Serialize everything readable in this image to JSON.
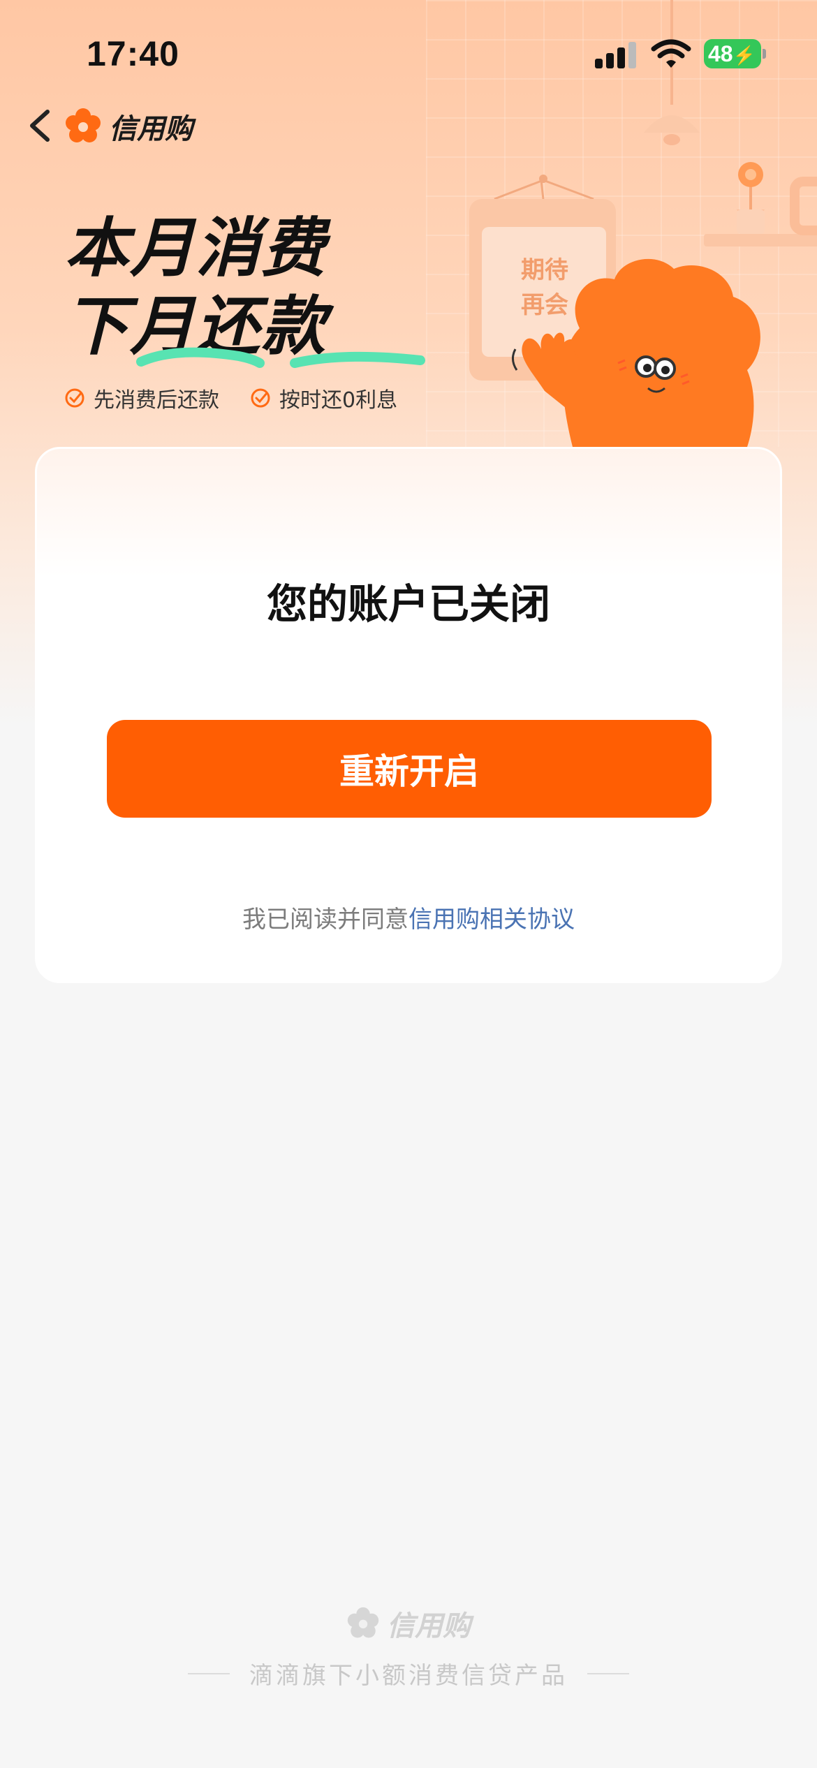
{
  "status_bar": {
    "time": "17:40",
    "battery": "48"
  },
  "nav": {
    "brand_name": "信用购"
  },
  "hero": {
    "line1": "本月消费",
    "line2": "下月还款",
    "features": [
      "先消费后还款",
      "按时还0利息"
    ],
    "sign_text": [
      "期待",
      "再会"
    ]
  },
  "card": {
    "title": "您的账户已关闭",
    "button_label": "重新开启",
    "agreement_prefix": "我已阅读并同意",
    "agreement_link": "信用购相关协议"
  },
  "footer": {
    "brand_name": "信用购",
    "tagline": "滴滴旗下小额消费信贷产品"
  },
  "colors": {
    "accent": "#ff5e03",
    "link": "#4a73b3",
    "battery": "#34c759"
  }
}
